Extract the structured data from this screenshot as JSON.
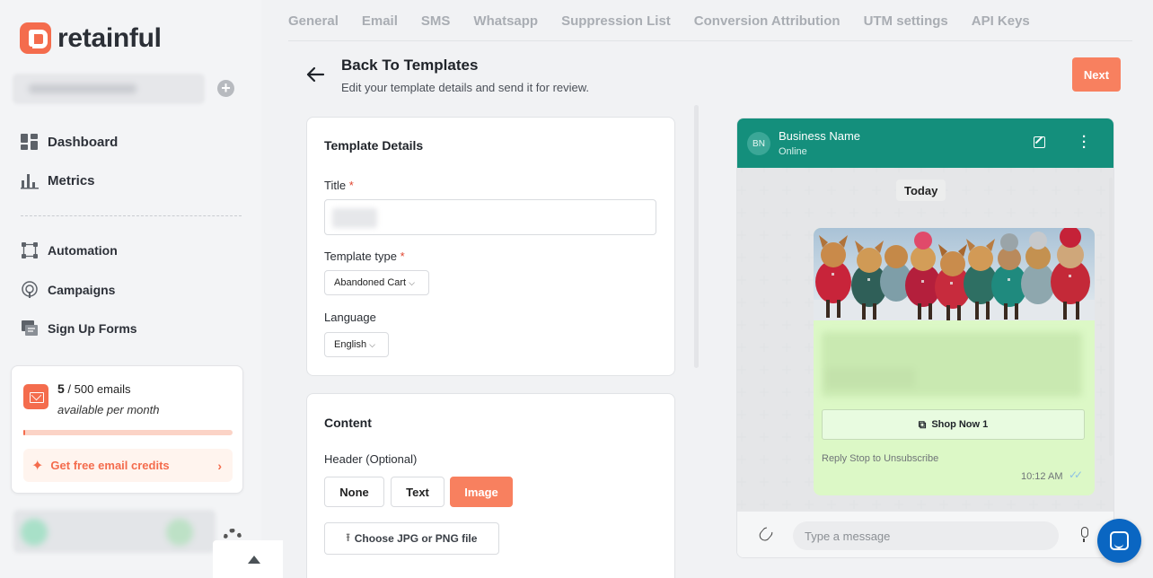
{
  "brand": {
    "name": "retainful",
    "color": "#f46c4d"
  },
  "sidebar": {
    "items": [
      {
        "label": "Dashboard",
        "icon": "dashboard-icon"
      },
      {
        "label": "Metrics",
        "icon": "bar-chart-icon"
      },
      {
        "label": "Automation",
        "icon": "automation-icon"
      },
      {
        "label": "Campaigns",
        "icon": "campaign-icon"
      },
      {
        "label": "Sign Up Forms",
        "icon": "form-icon"
      }
    ],
    "credits": {
      "used": "5",
      "suffix": " / 500 emails",
      "subtitle": "available per month",
      "progress_fraction": 0.01,
      "cta": "Get free email credits"
    }
  },
  "tabs": [
    "General",
    "Email",
    "SMS",
    "Whatsapp",
    "Suppression List",
    "Conversion Attribution",
    "UTM settings",
    "API Keys"
  ],
  "header": {
    "title": "Back To Templates",
    "subtitle": "Edit your template details and send it for review.",
    "next_label": "Next"
  },
  "details": {
    "title": "Template Details",
    "title_label": "Title",
    "required_mark": "*",
    "type_label": "Template type",
    "type_value": "Abandoned Cart",
    "language_label": "Language",
    "language_value": "English"
  },
  "content": {
    "title": "Content",
    "header_label": "Header (Optional)",
    "header_options": [
      "None",
      "Text",
      "Image"
    ],
    "selected_header": "Image",
    "file_button": "Choose JPG or PNG file"
  },
  "preview": {
    "avatar": "BN",
    "business_name": "Business Name",
    "status": "Online",
    "day": "Today",
    "button_label": "Shop Now 1",
    "footer_text": "Reply Stop to Unsubscribe",
    "time": "10:12 AM",
    "input_placeholder": "Type a message",
    "header_color": "#148f7c",
    "bubble_color": "#dcf8c6"
  }
}
